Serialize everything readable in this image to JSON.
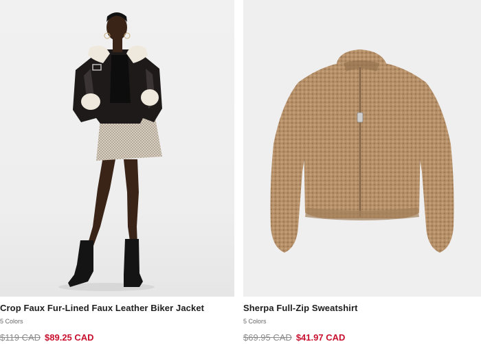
{
  "products": [
    {
      "title": "Crop Faux Fur-Lined Faux Leather Biker Jacket",
      "colors": "5 Colors",
      "original_price": "$119 CAD",
      "sale_price": "$89.25 CAD",
      "image_icon": "model-wearing-biker-jacket-image"
    },
    {
      "title": "Sherpa Full-Zip Sweatshirt",
      "colors": "5 Colors",
      "original_price": "$69.95 CAD",
      "sale_price": "$41.97 CAD",
      "image_icon": "sherpa-sweatshirt-image"
    }
  ],
  "theme": {
    "sale_color": "#c8102e",
    "original_price_color": "#8a8a8a",
    "sherpa_color": "#b48e66"
  }
}
